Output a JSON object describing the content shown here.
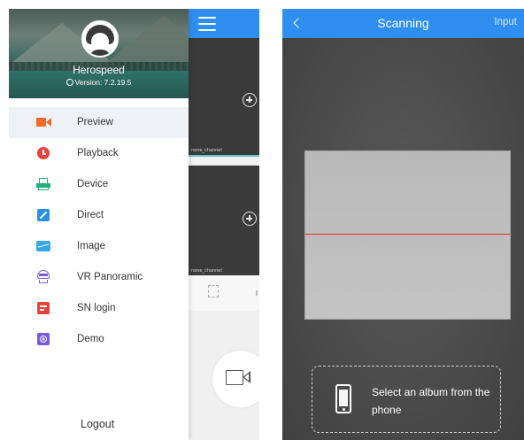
{
  "left_screen": {
    "drawer": {
      "user_name": "Herospeed",
      "version": "Version: 7.2.19.5",
      "menu": [
        {
          "label": "Preview",
          "icon": "preview-camera-icon",
          "color": "#f06a2a",
          "active": true
        },
        {
          "label": "Playback",
          "icon": "playback-clock-icon",
          "color": "#e8413c"
        },
        {
          "label": "Device",
          "icon": "device-printer-icon",
          "color": "#22b07a"
        },
        {
          "label": "Direct",
          "icon": "direct-link-icon",
          "color": "#2b8fe6"
        },
        {
          "label": "Image",
          "icon": "image-icon",
          "color": "#35a8e8"
        },
        {
          "label": "VR Panoramic",
          "icon": "vr-panoramic-icon",
          "color": "#7a5ad8"
        },
        {
          "label": "SN login",
          "icon": "sn-login-icon",
          "color": "#e8413c"
        },
        {
          "label": "Demo",
          "icon": "demo-icon",
          "color": "#7a5ad8"
        }
      ],
      "logout_label": "Logout"
    },
    "preview": {
      "tiles": [
        {
          "label": "none_channel"
        },
        {
          "label": "none_channel"
        }
      ],
      "header_color": "#2f8ff0"
    }
  },
  "right_screen": {
    "header": {
      "title": "Scanning",
      "right_action": "Input",
      "color": "#2f8ff0"
    },
    "album_button": {
      "text": "Select an album from the phone"
    },
    "scan_line_color": "#e22a2a"
  }
}
